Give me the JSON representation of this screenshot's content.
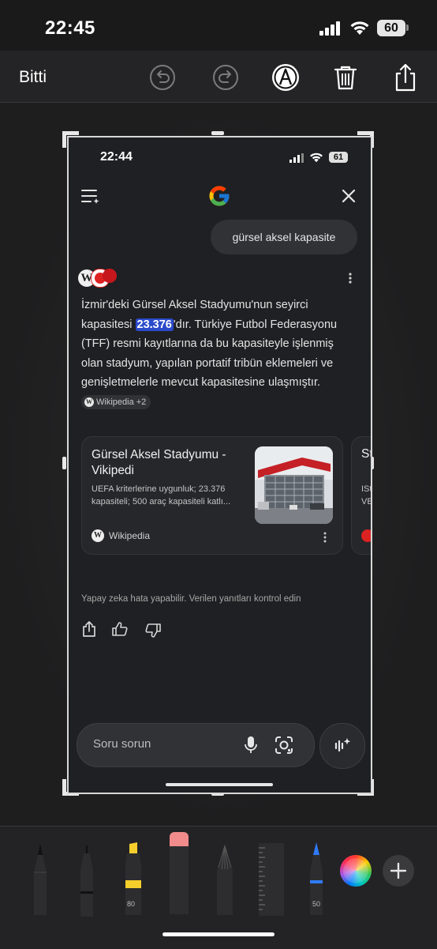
{
  "status_bar": {
    "time": "22:45",
    "battery": "60"
  },
  "toolbar": {
    "done_label": "Bitti",
    "icons": [
      "undo-icon",
      "redo-icon",
      "markup-icon",
      "trash-icon",
      "share-icon"
    ]
  },
  "screenshot": {
    "status_bar": {
      "time": "22:44",
      "battery": "61"
    },
    "query": "gürsel aksel kapasite",
    "answer": {
      "before": "İzmir'deki Gürsel Aksel Stadyumu'nun seyirci kapasitesi ",
      "highlight": "23.376",
      "after": "'dır. Türkiye Futbol Federasyonu (TFF) resmi kayıtlarına da bu kapasiteyle işlenmiş olan stadyum, yapılan portatif tribün eklemeleri ve genişletmelerle mevcut kapasitesine ulaşmıştır.",
      "source_chip": "Wikipedia +2"
    },
    "card": {
      "title": "Gürsel Aksel Stadyumu - Vikipedi",
      "description": "UEFA kriterlerine uygunluk; 23.376 kapasiteli; 500 araç kapasiteli katlı...",
      "source": "Wikipedia"
    },
    "card2": {
      "title": "St",
      "desc1": "ISt",
      "desc2": "VE"
    },
    "disclaimer": "Yapay zeka hata yapabilir. Verilen yanıtları kontrol edin",
    "ask_placeholder": "Soru sorun"
  },
  "tools": {
    "highlighter_value": "80",
    "pen_value": "50",
    "items": [
      "pen",
      "fineliner",
      "highlighter",
      "eraser",
      "pencil",
      "ruler",
      "blue-pen",
      "color-picker",
      "add"
    ]
  },
  "colors": {
    "accent_blue": "#2b4acb",
    "highlighter_yellow": "#f7cf2c",
    "eraser_pink": "#f28b8b",
    "pen_blue": "#2f7bf6"
  }
}
